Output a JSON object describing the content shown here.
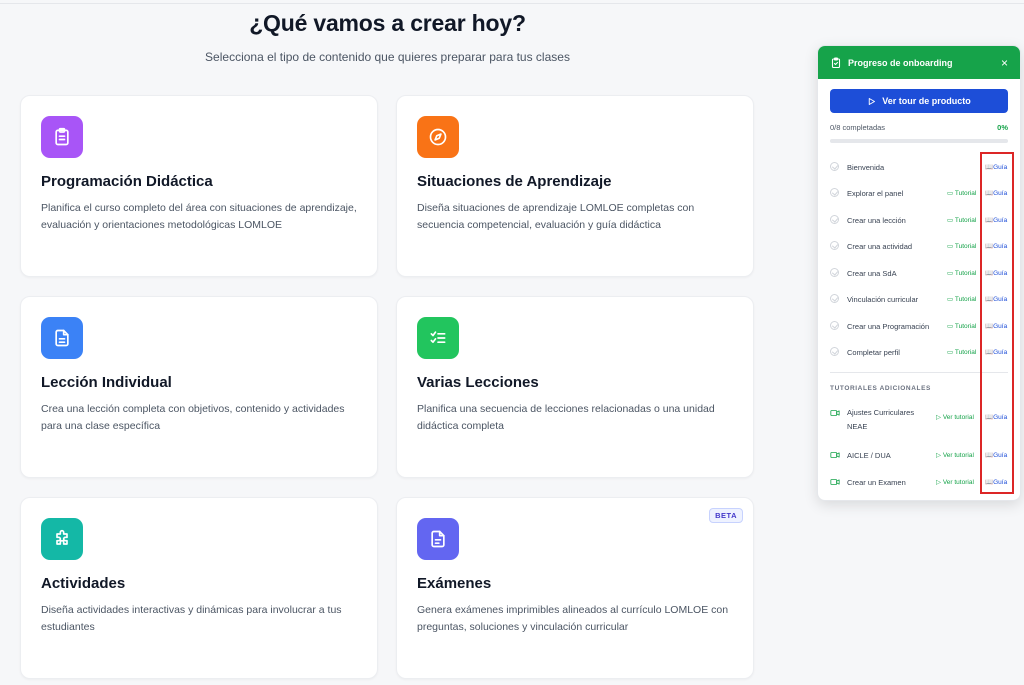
{
  "header": {
    "title": "¿Qué vamos a crear hoy?",
    "subtitle": "Selecciona el tipo de contenido que quieres preparar para tus clases"
  },
  "cards": [
    {
      "title": "Programación Didáctica",
      "description": "Planifica el curso completo del área con situaciones de aprendizaje, evaluación y orientaciones metodológicas LOMLOE",
      "icon": "clipboard-icon",
      "color": "#a855f7"
    },
    {
      "title": "Situaciones de Aprendizaje",
      "description": "Diseña situaciones de aprendizaje LOMLOE completas con secuencia competencial, evaluación y guía didáctica",
      "icon": "compass-icon",
      "color": "#f97316"
    },
    {
      "title": "Lección Individual",
      "description": "Crea una lección completa con objetivos, contenido y actividades para una clase específica",
      "icon": "document-icon",
      "color": "#3b82f6"
    },
    {
      "title": "Varias Lecciones",
      "description": "Planifica una secuencia de lecciones relacionadas o una unidad didáctica completa",
      "icon": "checklist-icon",
      "color": "#22c55e"
    },
    {
      "title": "Actividades",
      "description": "Diseña actividades interactivas y dinámicas para involucrar a tus estudiantes",
      "icon": "puzzle-icon",
      "color": "#14b8a6"
    },
    {
      "title": "Exámenes",
      "description": "Genera exámenes imprimibles alineados al currículo LOMLOE con preguntas, soluciones y vinculación curricular",
      "icon": "exam-document-icon",
      "color": "#6366f1",
      "badge": "BETA"
    }
  ],
  "onboarding": {
    "title": "Progreso de onboarding",
    "close": "×",
    "tour_button": "Ver tour de producto",
    "progress_text": "0/8 completadas",
    "progress_pct": "0%",
    "progress_fraction": 0,
    "steps": [
      {
        "label": "Bienvenida",
        "tutorial": "",
        "guide": "Guía"
      },
      {
        "label": "Explorar el panel",
        "tutorial": "Tutorial",
        "guide": "Guía"
      },
      {
        "label": "Crear una lección",
        "tutorial": "Tutorial",
        "guide": "Guía"
      },
      {
        "label": "Crear una actividad",
        "tutorial": "Tutorial",
        "guide": "Guía"
      },
      {
        "label": "Crear una SdA",
        "tutorial": "Tutorial",
        "guide": "Guía"
      },
      {
        "label": "Vinculación curricular",
        "tutorial": "Tutorial",
        "guide": "Guía"
      },
      {
        "label": "Crear una Programación",
        "tutorial": "Tutorial",
        "guide": "Guía"
      },
      {
        "label": "Completar perfil",
        "tutorial": "Tutorial",
        "guide": "Guía"
      }
    ],
    "section_label": "TUTORIALES ADICIONALES",
    "additional": [
      {
        "label_line1": "Ajustes Curriculares",
        "label_line2": "NEAE",
        "tutorial": "Ver tutorial",
        "guide": "Guía"
      },
      {
        "label_line1": "AICLE / DUA",
        "label_line2": "",
        "tutorial": "Ver tutorial",
        "guide": "Guía"
      },
      {
        "label_line1": "Crear un Examen",
        "label_line2": "",
        "tutorial": "Ver tutorial",
        "guide": "Guía"
      }
    ],
    "accent": "#16a34a",
    "button_color": "#1d4ed8"
  }
}
